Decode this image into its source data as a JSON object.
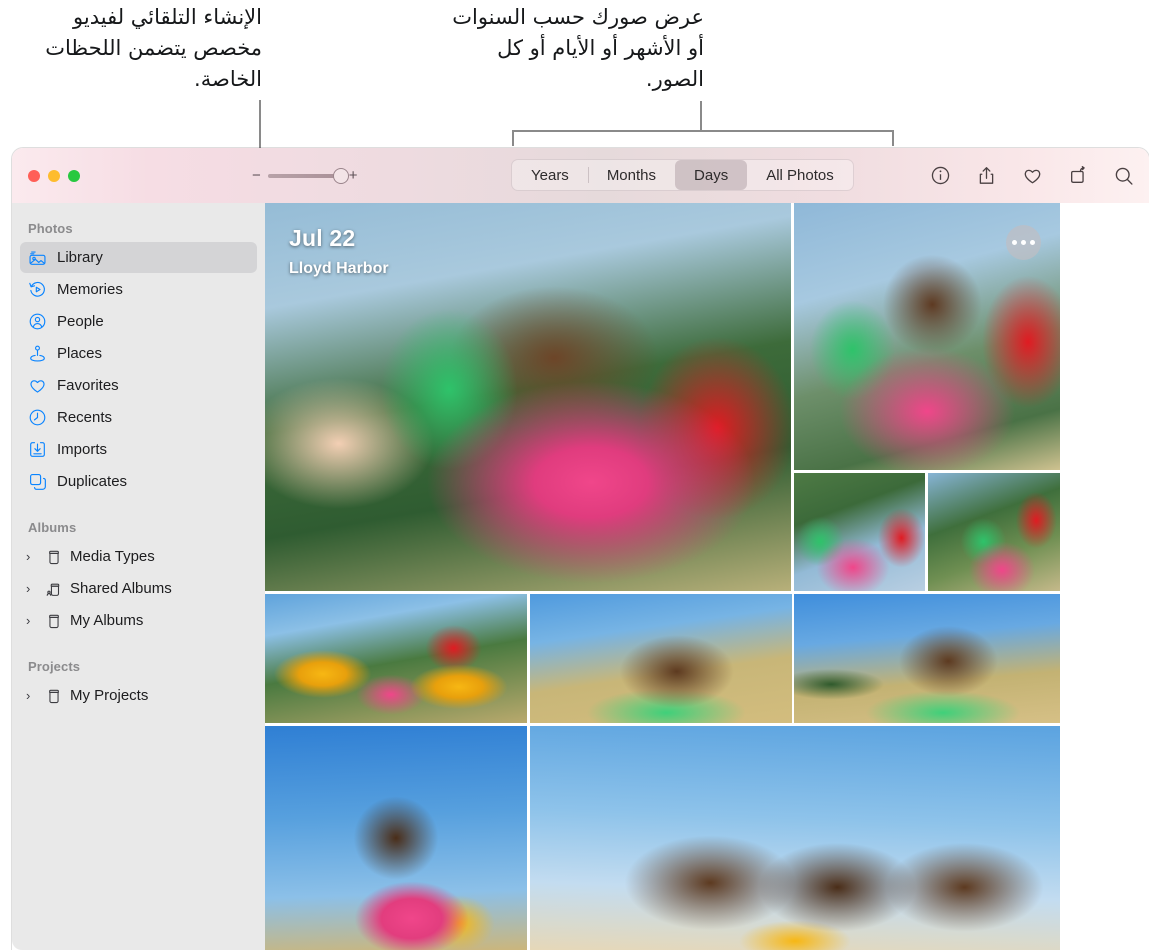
{
  "callouts": {
    "left": "الإنشاء التلقائي لفيديو مخصص يتضمن اللحظات الخاصة.",
    "right": "عرض صورك حسب السنوات أو الأشهر أو الأيام أو كل الصور."
  },
  "window": {
    "traffic_lights": [
      "close",
      "minimize",
      "zoom"
    ]
  },
  "toolbar": {
    "zoom_out_label": "−",
    "zoom_in_label": "+",
    "segments": [
      {
        "label": "Years",
        "selected": false
      },
      {
        "label": "Months",
        "selected": false
      },
      {
        "label": "Days",
        "selected": true
      },
      {
        "label": "All Photos",
        "selected": false
      }
    ],
    "icons": [
      "info-icon",
      "share-icon",
      "heart-icon",
      "rotate-icon",
      "search-icon"
    ]
  },
  "sidebar": {
    "sections": [
      {
        "title": "Photos",
        "items": [
          {
            "label": "Library",
            "icon": "library-icon",
            "active": true
          },
          {
            "label": "Memories",
            "icon": "memories-icon",
            "active": false
          },
          {
            "label": "People",
            "icon": "people-icon",
            "active": false
          },
          {
            "label": "Places",
            "icon": "places-icon",
            "active": false
          },
          {
            "label": "Favorites",
            "icon": "heart-icon",
            "active": false
          },
          {
            "label": "Recents",
            "icon": "clock-icon",
            "active": false
          },
          {
            "label": "Imports",
            "icon": "import-icon",
            "active": false
          },
          {
            "label": "Duplicates",
            "icon": "duplicates-icon",
            "active": false
          }
        ]
      },
      {
        "title": "Albums",
        "items": [
          {
            "label": "Media Types",
            "icon": "album-icon",
            "group": true
          },
          {
            "label": "Shared Albums",
            "icon": "shared-album-icon",
            "group": true
          },
          {
            "label": "My Albums",
            "icon": "album-icon",
            "group": true
          }
        ]
      },
      {
        "title": "Projects",
        "items": [
          {
            "label": "My Projects",
            "icon": "album-icon",
            "group": true
          }
        ]
      }
    ]
  },
  "grid": {
    "day_label": "Jul 22",
    "place_label": "Lloyd Harbor",
    "more_button": "more-options"
  },
  "colors": {
    "accent": "#0a84ff",
    "sidebar_bg": "#e9e9e9",
    "selected_row": "#d4d4d6",
    "toolbar_pink": "#f4dde3",
    "callout_line": "#8a8a8a"
  }
}
